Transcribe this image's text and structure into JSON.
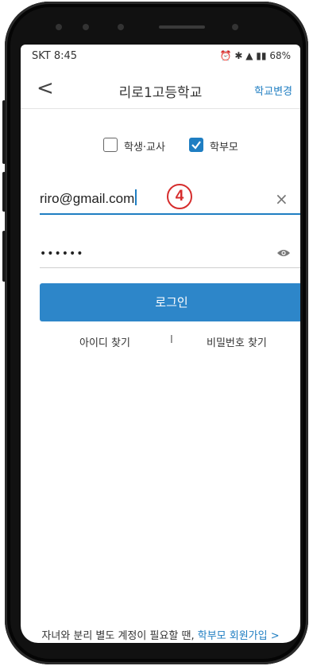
{
  "status_bar": {
    "carrier_time": "SKT 8:45",
    "right_info": "68%"
  },
  "header": {
    "back_glyph": "<",
    "title": "리로1고등학교",
    "change_school": "학교변경"
  },
  "roles": {
    "student_teacher": "학생·교사",
    "parent": "학부모",
    "parent_checked": true
  },
  "login_form": {
    "email_value": "riro@gmail.com",
    "password_masked": "••••••",
    "clear_glyph": "×",
    "login_button": "로그인",
    "step_marker": "4"
  },
  "links": {
    "find_id": "아이디 찾기",
    "separator": "I",
    "find_password": "비밀번호 찾기"
  },
  "footer": {
    "prompt": "자녀와 분리 별도 계정이 필요할 땐,",
    "signup_link": "학부모 회원가입",
    "arrow": ">"
  },
  "colors": {
    "accent": "#1f7ec2",
    "button": "#2d86c9",
    "marker": "#d62d2d"
  }
}
